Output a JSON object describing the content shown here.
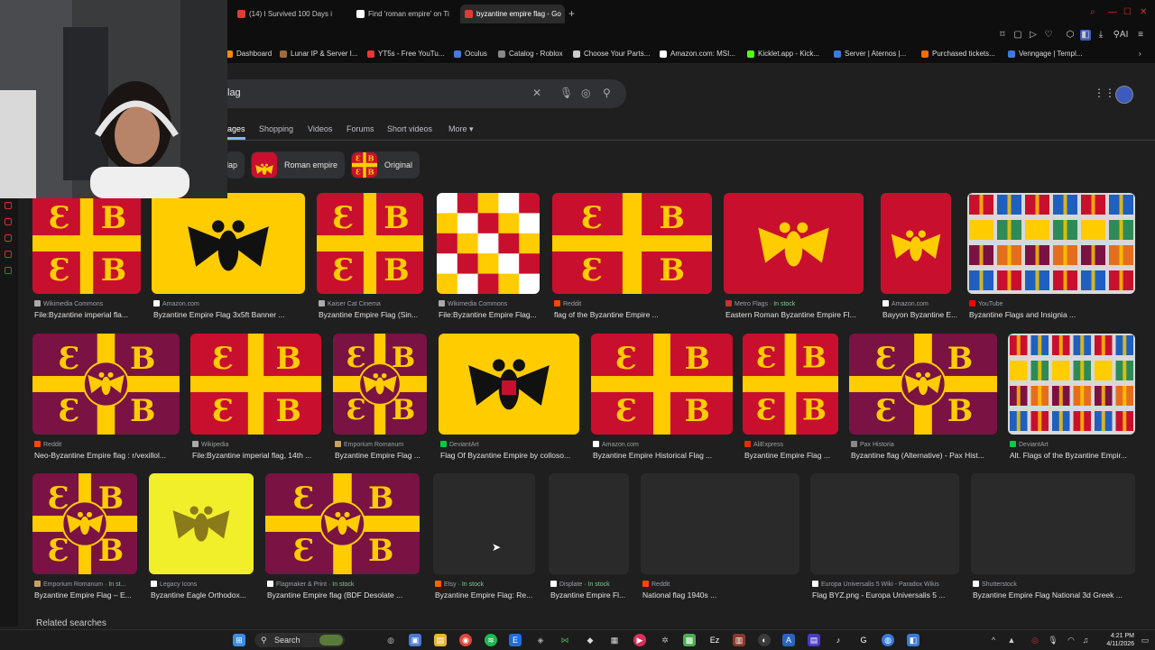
{
  "tabs": [
    {
      "label": "(14) I Survived 100 Days i",
      "fav": "#e53935"
    },
    {
      "label": "Find 'roman empire' on Ti",
      "fav": "#ffffff"
    },
    {
      "label": "byzantine empire flag - Go",
      "fav": "#e53935"
    }
  ],
  "bookmarks": [
    {
      "label": "Dashboard",
      "color": "#ff8a00"
    },
    {
      "label": "Lunar IP & Server I...",
      "color": "#9c6b3c"
    },
    {
      "label": "YT5s - Free YouTu...",
      "color": "#e53935"
    },
    {
      "label": "Oculus",
      "color": "#4a7ad8"
    },
    {
      "label": "Catalog - Roblox",
      "color": "#888888"
    },
    {
      "label": "Choose Your Parts...",
      "color": "#cccccc"
    },
    {
      "label": "Amazon.com: MSI...",
      "color": "#ffffff"
    },
    {
      "label": "Kicklet.app - Kick...",
      "color": "#53fc18"
    },
    {
      "label": "Server | Aternos |...",
      "color": "#3b7ae0"
    },
    {
      "label": "Purchased tickets...",
      "color": "#ff6a00"
    },
    {
      "label": "Venngage | Templ...",
      "color": "#3b7ae0"
    }
  ],
  "search": {
    "query": "lag"
  },
  "nav_tabs": [
    {
      "label": "ages",
      "selected": true
    },
    {
      "label": "Shopping",
      "selected": false
    },
    {
      "label": "Videos",
      "selected": false
    },
    {
      "label": "Forums",
      "selected": false
    },
    {
      "label": "Short videos",
      "selected": false
    },
    {
      "label": "More ▾",
      "selected": false
    }
  ],
  "chips": [
    {
      "label": "lap"
    },
    {
      "label": "Roman empire"
    },
    {
      "label": "Original"
    }
  ],
  "results": [
    {
      "source": "Wikimedia Commons",
      "stock": "",
      "title": "File:Byzantine imperial fla...",
      "style": "yr",
      "src_color": "#aaaaaa"
    },
    {
      "source": "Amazon.com",
      "stock": "",
      "title": "Byzantine Empire Flag 3x5ft Banner ...",
      "style": "eagle",
      "src_color": "#ffffff"
    },
    {
      "source": "Kaiser Cat Cinema",
      "stock": "",
      "title": "Byzantine Empire Flag (Sin...",
      "style": "yr",
      "src_color": "#aaaaaa"
    },
    {
      "source": "Wikimedia Commons",
      "stock": "",
      "title": "File:Byzantine Empire Flag...",
      "style": "grid",
      "src_color": "#aaaaaa"
    },
    {
      "source": "Reddit",
      "stock": "",
      "title": "flag of the Byzantine Empire ...",
      "style": "yr",
      "src_color": "#ff4500"
    },
    {
      "source": "Metro Flags",
      "stock": "In stock",
      "title": "Eastern Roman Byzantine Empire Fl...",
      "style": "redeagle",
      "src_color": "#d32f2f"
    },
    {
      "source": "Amazon.com",
      "stock": "",
      "title": "Bayyon Byzantine E...",
      "style": "redeagle",
      "src_color": "#ffffff"
    },
    {
      "source": "YouTube",
      "stock": "",
      "title": "Byzantine Flags and Insignia ...",
      "style": "collage",
      "src_color": "#ff0000"
    },
    {
      "source": "Reddit",
      "stock": "",
      "title": "Neo-Byzantine Empire flag : r/vexillol...",
      "style": "purple",
      "src_color": "#ff4500"
    },
    {
      "source": "Wikipedia",
      "stock": "",
      "title": "File:Byzantine imperial flag, 14th ...",
      "style": "yr",
      "src_color": "#aaaaaa"
    },
    {
      "source": "Emporium Romanum",
      "stock": "",
      "title": "Byzantine Empire Flag ...",
      "style": "purple",
      "src_color": "#caa060"
    },
    {
      "source": "DeviantArt",
      "stock": "",
      "title": "Flag Of Byzantine Empire by colloso...",
      "style": "blackeagle",
      "src_color": "#05cc47"
    },
    {
      "source": "Amazon.com",
      "stock": "",
      "title": "Byzantine Empire Historical Flag ...",
      "style": "yr",
      "src_color": "#ffffff"
    },
    {
      "source": "AliExpress",
      "stock": "",
      "title": "Byzantine Empire Flag ...",
      "style": "yr",
      "src_color": "#e62e04"
    },
    {
      "source": "Pax Historia",
      "stock": "",
      "title": "Byzantine flag (Alternative) - Pax Hist...",
      "style": "purple",
      "src_color": "#888888"
    },
    {
      "source": "DeviantArt",
      "stock": "",
      "title": "Alt. Flags of the Byzantine Empir...",
      "style": "collage",
      "src_color": "#05cc47"
    },
    {
      "source": "Emporium Romanum",
      "stock": "In st...",
      "title": "Byzantine Empire Flag – E...",
      "style": "purple",
      "src_color": "#caa060"
    },
    {
      "source": "Legacy Icons",
      "stock": "",
      "title": "Byzantine Eagle Orthodox...",
      "style": "lime",
      "src_color": "#ffffff"
    },
    {
      "source": "Flagmaker & Print",
      "stock": "In stock",
      "title": "Byzantine Empire flag (BDF Desolate ...",
      "style": "purple",
      "src_color": "#ffffff"
    },
    {
      "source": "Etsy",
      "stock": "In stock",
      "title": "Byzantine Empire Flag: Re...",
      "style": "ph",
      "src_color": "#f56400"
    },
    {
      "source": "Displate",
      "stock": "In stock",
      "title": "Byzantine Empire Fl...",
      "style": "ph",
      "src_color": "#ffffff"
    },
    {
      "source": "Reddit",
      "stock": "",
      "title": "National flag 1940s ...",
      "style": "ph",
      "src_color": "#ff4500"
    },
    {
      "source": "Europa Universalis 5 Wiki - Paradox Wikis",
      "stock": "",
      "title": "Flag BYZ.png - Europa Universalis 5 ...",
      "style": "ph",
      "src_color": "#ffffff"
    },
    {
      "source": "Shutterstock",
      "stock": "",
      "title": "Byzantine Empire Flag National 3d Greek ...",
      "style": "ph",
      "src_color": "#ffffff"
    }
  ],
  "related_heading": "Related searches",
  "taskbar": {
    "search_label": "Search"
  },
  "clock": {
    "time": "4:21 PM",
    "date": "4/11/2026"
  },
  "colors": {
    "background": "#1f1f1f",
    "flag_red": "#c8102e",
    "flag_yellow": "#ffcc00",
    "flag_purple": "#7a1244"
  }
}
